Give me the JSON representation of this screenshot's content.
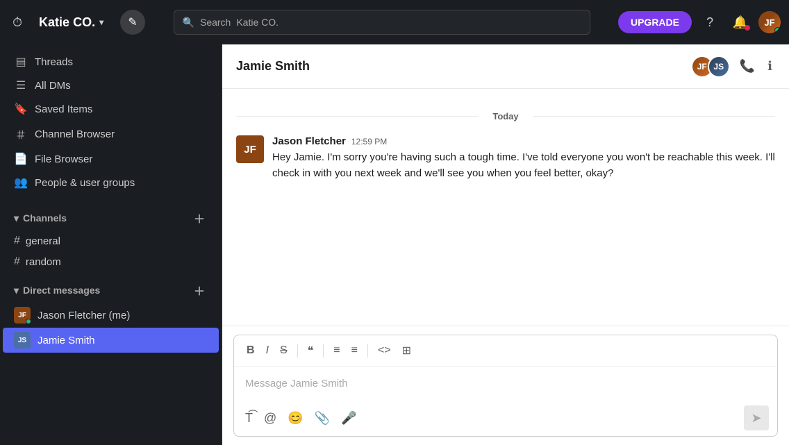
{
  "topbar": {
    "workspace_name": "Katie CO.",
    "search_placeholder": "Search",
    "search_workspace": "Katie CO.",
    "upgrade_label": "UPGRADE",
    "edit_icon": "✏️",
    "history_icon": "⏱",
    "help_icon": "?",
    "notification_icon": "🔔"
  },
  "sidebar": {
    "nav_items": [
      {
        "id": "threads",
        "label": "Threads",
        "icon": "▤"
      },
      {
        "id": "all-dms",
        "label": "All DMs",
        "icon": "☰"
      },
      {
        "id": "saved-items",
        "label": "Saved Items",
        "icon": "🔖"
      },
      {
        "id": "channel-browser",
        "label": "Channel Browser",
        "icon": "#"
      },
      {
        "id": "file-browser",
        "label": "File Browser",
        "icon": "📄"
      },
      {
        "id": "people-groups",
        "label": "People & user groups",
        "icon": "👥"
      }
    ],
    "channels_section": "Channels",
    "channels": [
      {
        "id": "general",
        "name": "general"
      },
      {
        "id": "random",
        "name": "random"
      }
    ],
    "direct_messages_section": "Direct messages",
    "direct_messages": [
      {
        "id": "jason",
        "name": "Jason Fletcher (me)",
        "online": true,
        "active": false
      },
      {
        "id": "jamie",
        "name": "Jamie Smith",
        "online": false,
        "active": true
      }
    ]
  },
  "chat": {
    "title": "Jamie Smith",
    "date_label": "Today",
    "messages": [
      {
        "id": "msg1",
        "author": "Jason Fletcher",
        "time": "12:59 PM",
        "avatar_initials": "JF",
        "avatar_color": "#8B4513",
        "text": "Hey Jamie. I'm sorry you're having such a tough time. I've told everyone you won't be reachable this week. I'll check in with you next week and we'll see you when you feel better, okay?"
      }
    ],
    "compose_placeholder": "Message Jamie Smith",
    "toolbar_buttons": [
      "B",
      "I",
      "S",
      "❝",
      "≡",
      "≡",
      "<>",
      "⊞"
    ]
  }
}
